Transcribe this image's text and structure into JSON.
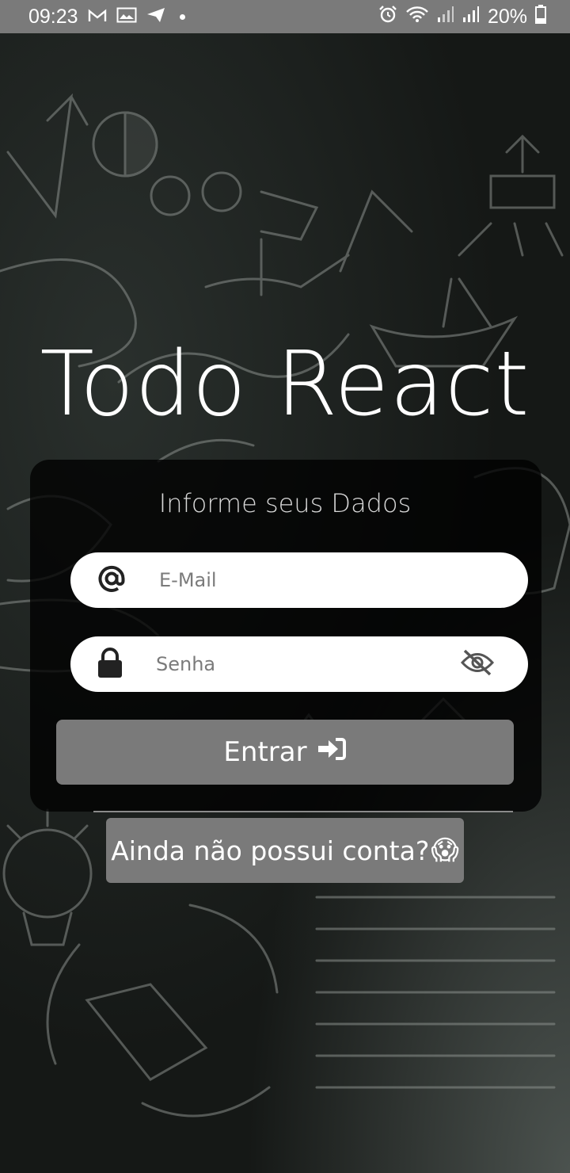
{
  "status_bar": {
    "time": "09:23",
    "battery": "20%",
    "left_icons": [
      "gmail-icon",
      "photo-icon",
      "send-icon",
      "dot-icon"
    ],
    "right_icons": [
      "alarm-icon",
      "wifi-icon",
      "signal-icon",
      "signal-icon",
      "battery-icon"
    ]
  },
  "app": {
    "title": "Todo React"
  },
  "form": {
    "heading": "Informe seus Dados",
    "email": {
      "placeholder": "E-Mail",
      "value": "",
      "icon": "at-icon"
    },
    "password": {
      "placeholder": "Senha",
      "value": "",
      "icon": "lock-icon",
      "toggle_icon": "eye-slash-icon"
    },
    "submit": {
      "label": "Entrar",
      "icon": "sign-in-icon"
    },
    "signup": {
      "label": "Ainda não possui conta?",
      "emoji": "😱"
    }
  },
  "colors": {
    "button_bg": "#7a7a7a",
    "card_bg": "#000000",
    "text": "#ffffff",
    "status_bar": "#7a7a7a"
  }
}
